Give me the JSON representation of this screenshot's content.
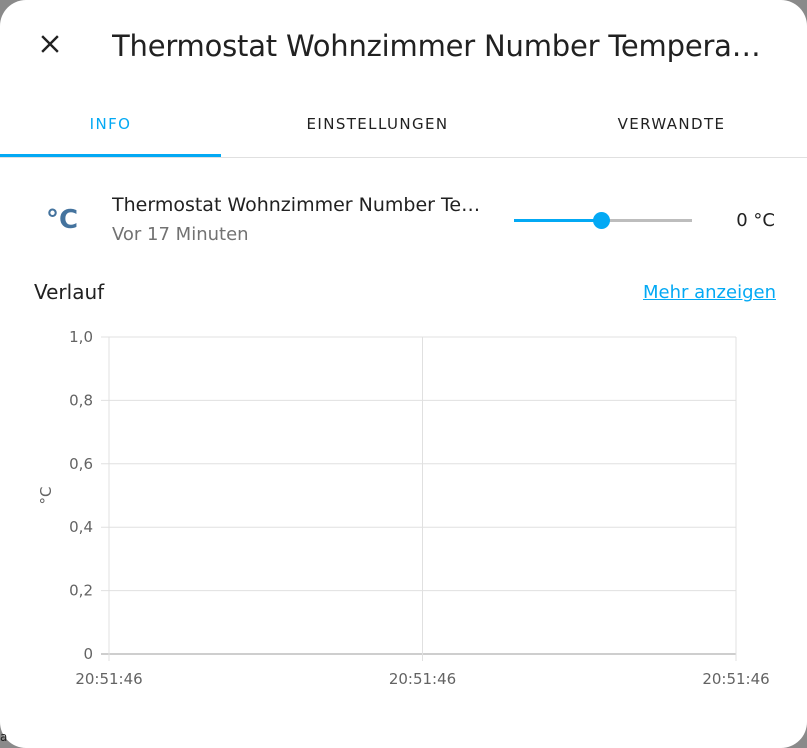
{
  "dialog": {
    "title": "Thermostat Wohnzimmer Number Temperatur",
    "close_icon": "close-icon"
  },
  "tabs": [
    {
      "label": "INFO",
      "active": true
    },
    {
      "label": "EINSTELLUNGEN",
      "active": false
    },
    {
      "label": "VERWANDTE",
      "active": false
    }
  ],
  "entity": {
    "icon_symbol": "°C",
    "icon": "temperature-celsius-icon",
    "name": "Thermostat Wohnzimmer Number Temperatur",
    "last_changed": "Vor 17 Minuten",
    "slider_fraction": 0.49,
    "value": "0 °C"
  },
  "history": {
    "title": "Verlauf",
    "more_link": "Mehr anzeigen"
  },
  "chart_data": {
    "type": "line",
    "ylabel": "°C",
    "ylim": [
      0,
      1
    ],
    "y_ticks": [
      "1,0",
      "0,8",
      "0,6",
      "0,4",
      "0,2",
      "0"
    ],
    "x_ticks": [
      "20:51:46",
      "20:51:46",
      "20:51:46"
    ],
    "grid": true,
    "series": []
  },
  "colors": {
    "accent": "#03a9f4",
    "icon": "#44739e"
  },
  "stray_char": "a"
}
